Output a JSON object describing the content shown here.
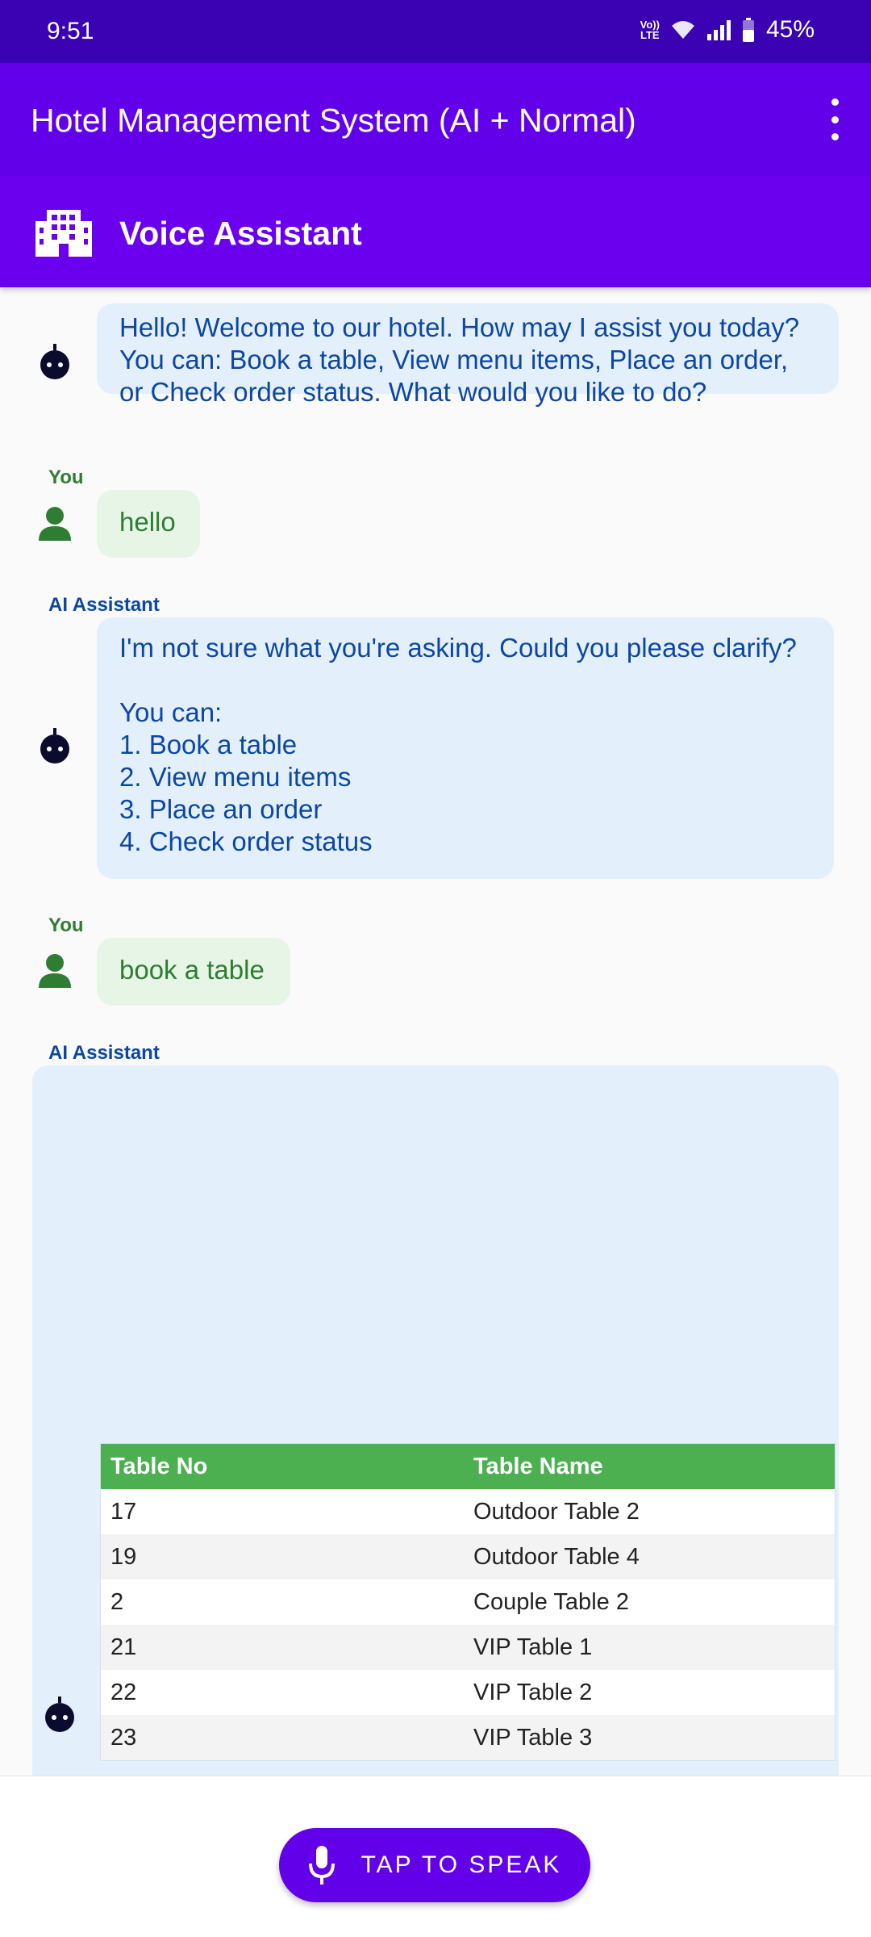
{
  "status_bar": {
    "time": "9:51",
    "network": "Vo)) LTE",
    "battery": "45%"
  },
  "app_bar": {
    "title": "Hotel Management System (AI + Normal)"
  },
  "sub_bar": {
    "title": "Voice Assistant",
    "icon": "hotel-building-icon"
  },
  "messages": [
    {
      "sender": "",
      "type": "ai",
      "text": "Hello! Welcome to our hotel. How may I assist you today?\nYou can: Book a table, View menu items, Place an order,\nor Check order status. What would you like to do?"
    },
    {
      "sender": "You",
      "type": "user",
      "text": "hello"
    },
    {
      "sender": "AI Assistant",
      "type": "ai",
      "text": "I'm not sure what you're asking. Could you please clarify?\n\nYou can:\n1. Book a table\n2. View menu items\n3. Place an order\n4. Check order status"
    },
    {
      "sender": "You",
      "type": "user",
      "text": "book a table"
    },
    {
      "sender": "AI Assistant",
      "type": "ai",
      "text": ""
    }
  ],
  "table": {
    "headers": [
      "Table No",
      "Table Name"
    ],
    "rows": [
      [
        "17",
        "Outdoor Table 2"
      ],
      [
        "19",
        "Outdoor Table 4"
      ],
      [
        "2",
        "Couple Table 2"
      ],
      [
        "21",
        "VIP Table 1"
      ],
      [
        "22",
        "VIP Table 2"
      ],
      [
        "23",
        "VIP Table 3"
      ]
    ]
  },
  "bottom": {
    "speak_label": "TAP TO SPEAK",
    "icon": "microphone-icon"
  },
  "colors": {
    "primary": "#6200ea",
    "status_bar": "#3a02b3",
    "ai_bubble": "#e3f0fc",
    "user_bubble": "#e7f5e7",
    "table_header": "#4caf50"
  }
}
